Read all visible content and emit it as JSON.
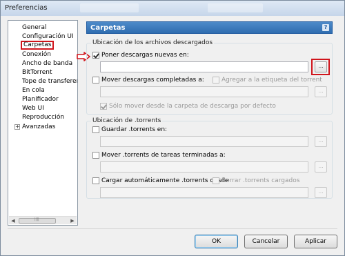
{
  "window": {
    "title": "Preferencias"
  },
  "sidebar": {
    "items": [
      {
        "label": "General"
      },
      {
        "label": "Configuración UI"
      },
      {
        "label": "Carpetas"
      },
      {
        "label": "Conexión"
      },
      {
        "label": "Ancho de banda"
      },
      {
        "label": "BitTorrent"
      },
      {
        "label": "Tope de transferencia"
      },
      {
        "label": "En cola"
      },
      {
        "label": "Planificador"
      },
      {
        "label": "Web UI"
      },
      {
        "label": "Reproducción"
      },
      {
        "label": "Avanzadas"
      }
    ],
    "selected": "Carpetas",
    "expander": "+"
  },
  "panel": {
    "title": "Carpetas",
    "help": "?",
    "downloads_group": {
      "legend": "Ubicación de los archivos descargados",
      "put_new": {
        "label": "Poner descargas nuevas en:",
        "checked": true,
        "value": ""
      },
      "move_completed": {
        "label": "Mover descargas completadas a:",
        "checked": false,
        "value": ""
      },
      "add_label": {
        "label": "Agregar a la etiqueta del torrent",
        "checked": false
      },
      "only_move": {
        "label": "Sólo mover desde la carpeta de descarga por defecto",
        "checked": true
      }
    },
    "torrents_group": {
      "legend": "Ubicación de .torrents",
      "save_torrents": {
        "label": "Guardar .torrents en:",
        "checked": false,
        "value": ""
      },
      "move_finished": {
        "label": "Mover .torrents de tareas terminadas a:",
        "checked": false,
        "value": ""
      },
      "autoload": {
        "label": "Cargar automáticamente .torrents desde",
        "checked": false,
        "value": ""
      },
      "delete_loaded": {
        "label": "Borrar .torrents cargados",
        "checked": false
      }
    },
    "browse_label": "..."
  },
  "buttons": {
    "ok": "OK",
    "cancel": "Cancelar",
    "apply": "Aplicar"
  },
  "colors": {
    "accent": "#2f6db0",
    "highlight": "#d0141b"
  }
}
